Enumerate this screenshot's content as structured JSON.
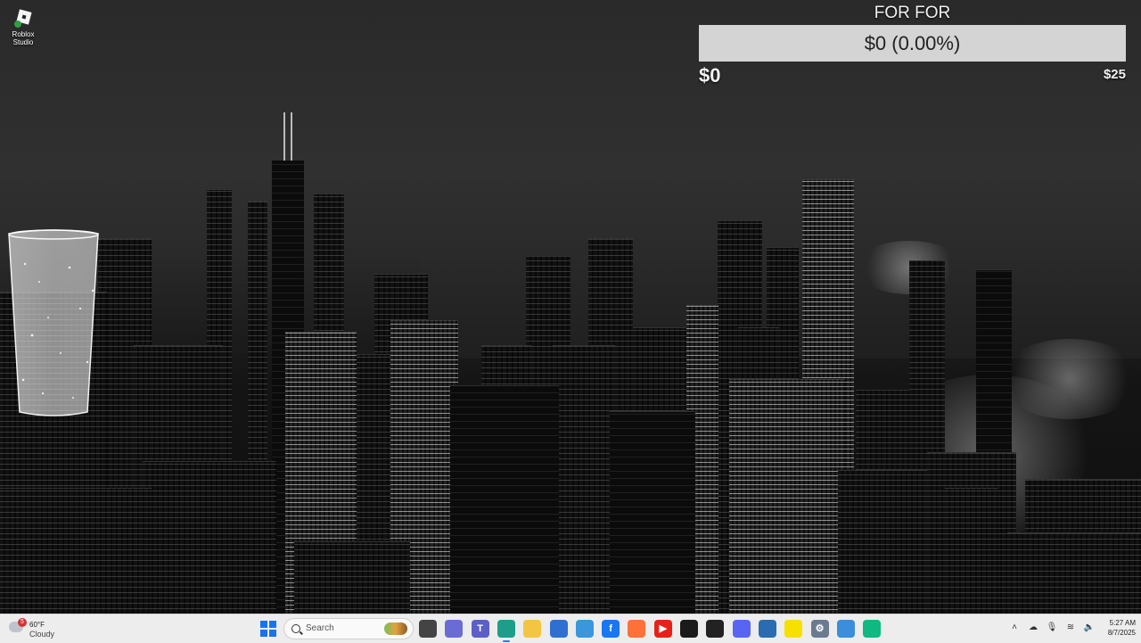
{
  "desktop": {
    "icons": [
      {
        "label_line1": "Roblox",
        "label_line2": "Studio",
        "icon": "roblox-studio-icon"
      }
    ]
  },
  "donation_goal": {
    "title": "FOR FOR",
    "progress_text": "$0 (0.00%)",
    "progress_fraction": 0.0,
    "min_label": "$0",
    "max_label": "$25",
    "bar_color": "#d4d4d4",
    "fill_color": "#7dd37d"
  },
  "taskbar": {
    "weather": {
      "badge": "5",
      "temperature": "60°F",
      "condition": "Cloudy"
    },
    "search_placeholder": "Search",
    "apps": [
      {
        "name": "file-explorer-alt",
        "icon": "task-view-icon",
        "color": "#444444",
        "glyph": ""
      },
      {
        "name": "copilot",
        "icon": "copilot-icon",
        "color": "#6b6bd6",
        "glyph": ""
      },
      {
        "name": "teams",
        "icon": "teams-icon",
        "color": "#5b5fc7",
        "glyph": "T"
      },
      {
        "name": "edge",
        "icon": "edge-icon",
        "color": "#1e9e8a",
        "glyph": "",
        "active": true
      },
      {
        "name": "file-explorer",
        "icon": "folder-icon",
        "color": "#f4c542",
        "glyph": ""
      },
      {
        "name": "mail",
        "icon": "mail-icon",
        "color": "#2f6fd1",
        "glyph": ""
      },
      {
        "name": "microsoft-store",
        "icon": "store-icon",
        "color": "#3a96dd",
        "glyph": ""
      },
      {
        "name": "facebook",
        "icon": "facebook-icon",
        "color": "#1877f2",
        "glyph": "f"
      },
      {
        "name": "firefox",
        "icon": "firefox-icon",
        "color": "#ff7139",
        "glyph": ""
      },
      {
        "name": "youtube",
        "icon": "youtube-icon",
        "color": "#e62117",
        "glyph": "▶"
      },
      {
        "name": "stocks-app",
        "icon": "chart-icon",
        "color": "#1a1a1a",
        "glyph": ""
      },
      {
        "name": "terminal-app",
        "icon": "terminal-icon",
        "color": "#222222",
        "glyph": ""
      },
      {
        "name": "discord",
        "icon": "discord-icon",
        "color": "#5865f2",
        "glyph": ""
      },
      {
        "name": "notepad",
        "icon": "notepad-icon",
        "color": "#2b6cb0",
        "glyph": ""
      },
      {
        "name": "snapchat",
        "icon": "snapchat-icon",
        "color": "#f7e000",
        "glyph": ""
      },
      {
        "name": "settings",
        "icon": "gear-icon",
        "color": "#6b7a8f",
        "glyph": "⚙"
      },
      {
        "name": "roblox-studio",
        "icon": "roblox-studio-icon",
        "color": "#3a8edb",
        "glyph": ""
      },
      {
        "name": "xbox-game-app",
        "icon": "game-icon",
        "color": "#10b981",
        "glyph": ""
      }
    ],
    "tray_icons": [
      {
        "name": "chevron-up-icon",
        "glyph": "˄"
      },
      {
        "name": "onedrive-icon",
        "glyph": "☁"
      },
      {
        "name": "microphone-icon",
        "glyph": "🎙"
      },
      {
        "name": "wifi-icon",
        "glyph": "≋"
      },
      {
        "name": "volume-icon",
        "glyph": "🔈"
      }
    ],
    "clock": {
      "time": "5:27 AM",
      "date": "8/7/2025"
    }
  }
}
